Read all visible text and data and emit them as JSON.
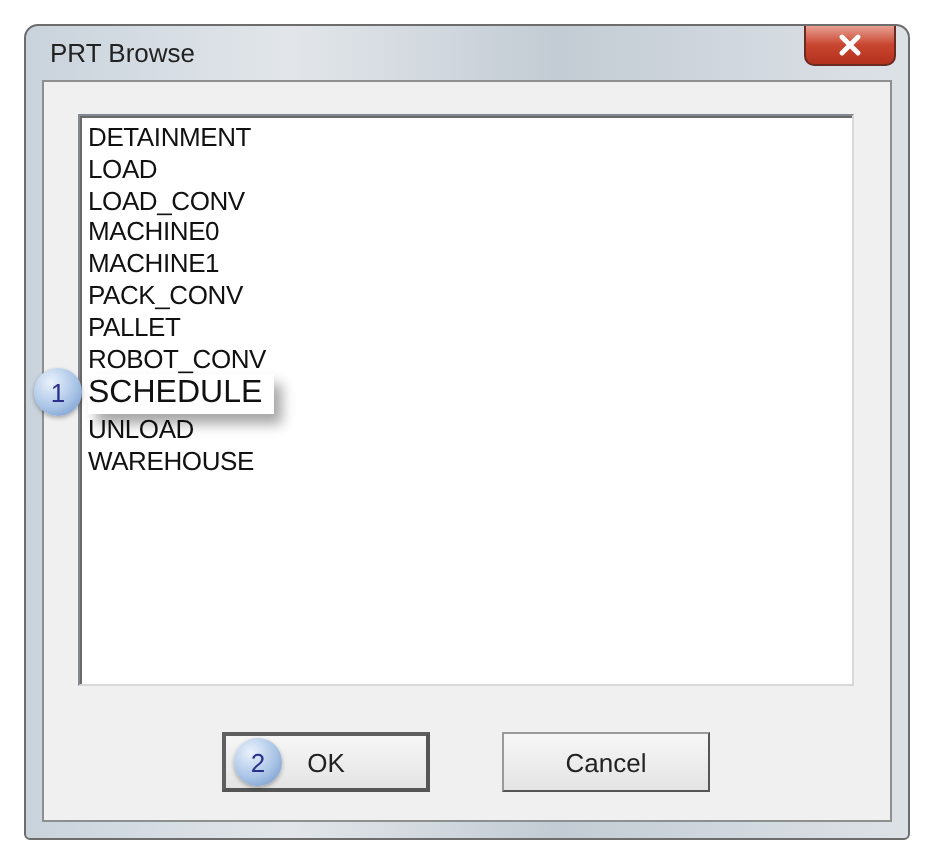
{
  "window": {
    "title": "PRT Browse"
  },
  "list": {
    "items": [
      {
        "label": "DETAINMENT",
        "highlighted": false
      },
      {
        "label": "LOAD",
        "highlighted": false
      },
      {
        "label": "LOAD_CONV",
        "highlighted": false
      },
      {
        "label": "MACHINE0",
        "highlighted": false
      },
      {
        "label": "MACHINE1",
        "highlighted": false
      },
      {
        "label": "PACK_CONV",
        "highlighted": false
      },
      {
        "label": "PALLET",
        "highlighted": false
      },
      {
        "label": "ROBOT_CONV",
        "highlighted": false
      },
      {
        "label": "SCHEDULE",
        "highlighted": true,
        "callout": "1"
      },
      {
        "label": "UNLOAD",
        "highlighted": false
      },
      {
        "label": "WAREHOUSE",
        "highlighted": false
      }
    ]
  },
  "buttons": [
    {
      "label": "OK",
      "default": true,
      "callout": "2"
    },
    {
      "label": "Cancel",
      "default": false
    }
  ]
}
